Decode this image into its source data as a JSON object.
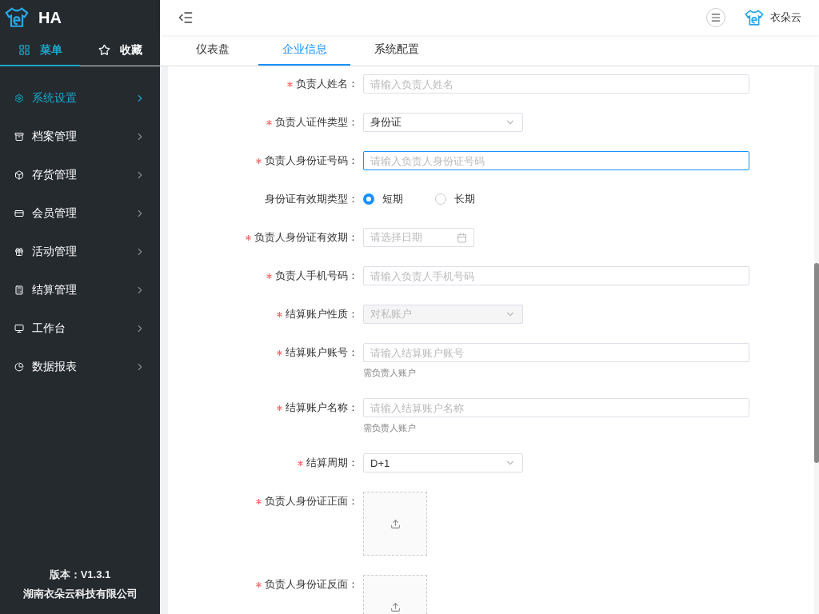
{
  "sidebar": {
    "logo_text": "HA",
    "tabs": [
      {
        "label": "菜单",
        "selected": true
      },
      {
        "label": "收藏",
        "selected": false
      }
    ],
    "items": [
      {
        "label": "系统设置",
        "selected": true
      },
      {
        "label": "档案管理",
        "selected": false
      },
      {
        "label": "存货管理",
        "selected": false
      },
      {
        "label": "会员管理",
        "selected": false
      },
      {
        "label": "活动管理",
        "selected": false
      },
      {
        "label": "结算管理",
        "selected": false
      },
      {
        "label": "工作台",
        "selected": false
      },
      {
        "label": "数据报表",
        "selected": false
      }
    ],
    "footer": [
      "版本：V1.3.1",
      "湖南衣朵云科技有限公司"
    ]
  },
  "header": {
    "user": "衣朵云"
  },
  "tabs": [
    {
      "label": "仪表盘",
      "selected": false
    },
    {
      "label": "企业信息",
      "selected": true
    },
    {
      "label": "系统配置",
      "selected": false
    }
  ],
  "form": [
    {
      "kind": "input",
      "label": "负责人姓名：",
      "required": true,
      "placeholder": "请输入负责人姓名",
      "focused": false
    },
    {
      "kind": "select",
      "label": "负责人证件类型：",
      "required": true,
      "value": "身份证",
      "disabled": false
    },
    {
      "kind": "input",
      "label": "负责人身份证号码：",
      "required": true,
      "placeholder": "请输入负责人身份证号码",
      "focused": true
    },
    {
      "kind": "radio",
      "label": "身份证有效期类型：",
      "required": false,
      "options": [
        {
          "label": "短期",
          "selected": true
        },
        {
          "label": "长期",
          "selected": false
        }
      ]
    },
    {
      "kind": "date",
      "label": "负责人身份证有效期：",
      "required": true,
      "placeholder": "请选择日期"
    },
    {
      "kind": "input",
      "label": "负责人手机号码：",
      "required": true,
      "placeholder": "请输入负责人手机号码",
      "focused": false
    },
    {
      "kind": "select",
      "label": "结算账户性质：",
      "required": true,
      "value": "对私账户",
      "disabled": true
    },
    {
      "kind": "input",
      "label": "结算账户账号：",
      "required": true,
      "placeholder": "请输入结算账户账号",
      "focused": false,
      "hint": "需负责人账户"
    },
    {
      "kind": "input",
      "label": "结算账户名称：",
      "required": true,
      "placeholder": "请输入结算账户名称",
      "focused": false,
      "hint": "需负责人账户"
    },
    {
      "kind": "select",
      "label": "结算周期：",
      "required": true,
      "value": "D+1",
      "disabled": false
    },
    {
      "kind": "upload",
      "label": "负责人身份证正面：",
      "required": true
    },
    {
      "kind": "upload",
      "label": "负责人身份证反面：",
      "required": true
    }
  ]
}
